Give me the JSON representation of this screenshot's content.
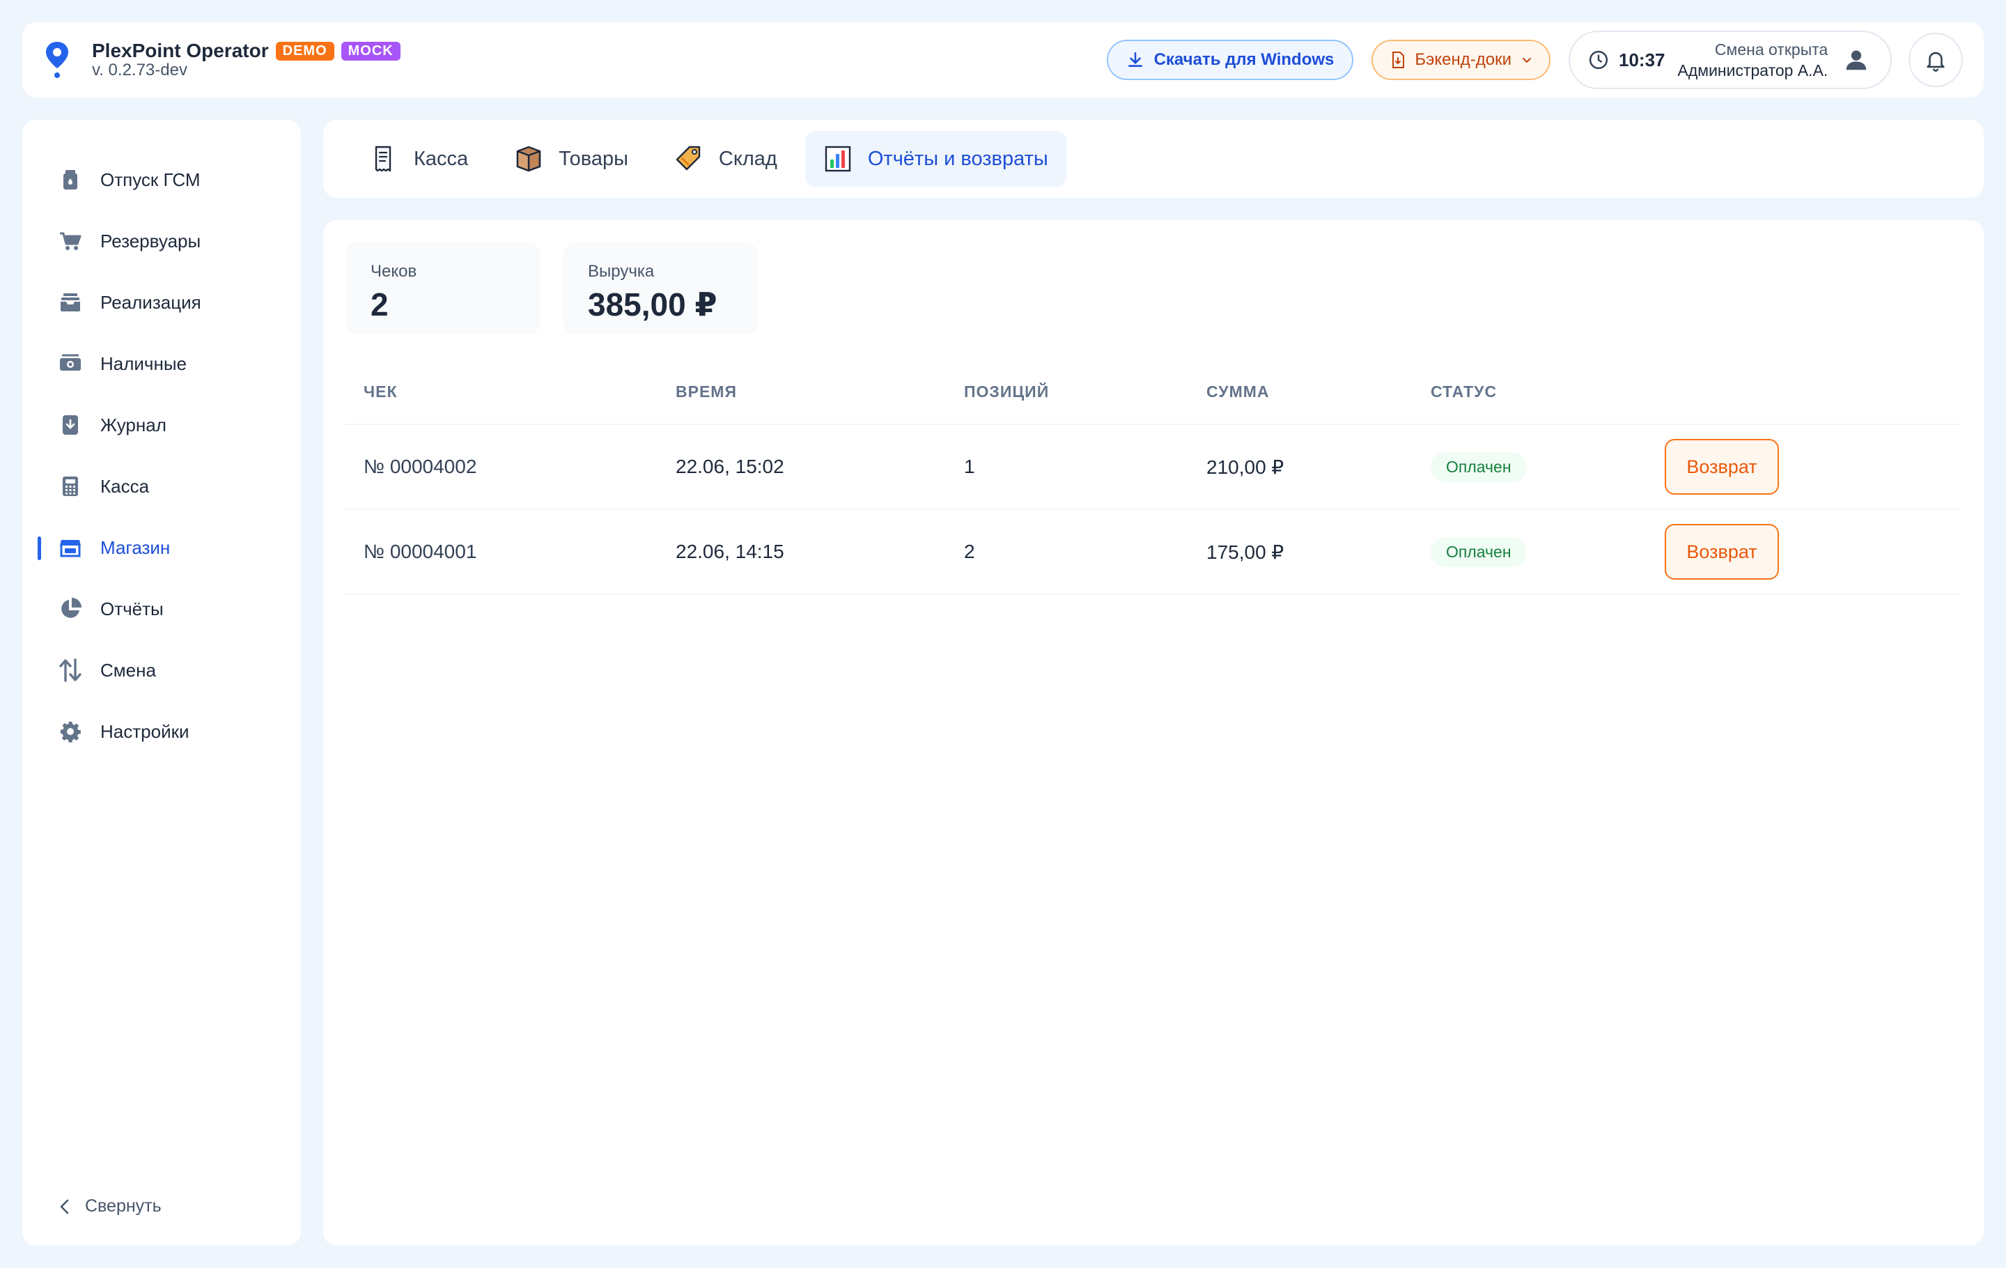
{
  "header": {
    "title": "PlexPoint Operator",
    "badge_demo": "DEMO",
    "badge_mock": "MOCK",
    "version": "v. 0.2.73-dev",
    "download_label": "Скачать для Windows",
    "docs_label": "Бэкенд-доки",
    "time": "10:37",
    "shift_status": "Смена открыта",
    "user": "Администратор А.А."
  },
  "sidebar": {
    "items": [
      {
        "label": "Отпуск ГСМ",
        "icon": "fuel-can-icon"
      },
      {
        "label": "Резервуары",
        "icon": "cart-icon"
      },
      {
        "label": "Реализация",
        "icon": "inbox-icon"
      },
      {
        "label": "Наличные",
        "icon": "cash-icon"
      },
      {
        "label": "Журнал",
        "icon": "journal-icon"
      },
      {
        "label": "Касса",
        "icon": "calculator-icon"
      },
      {
        "label": "Магазин",
        "icon": "store-icon"
      },
      {
        "label": "Отчёты",
        "icon": "pie-chart-icon"
      },
      {
        "label": "Смена",
        "icon": "swap-arrows-icon"
      },
      {
        "label": "Настройки",
        "icon": "gear-icon"
      }
    ],
    "active_index": 6,
    "collapse_label": "Свернуть"
  },
  "tabs": [
    {
      "label": "Касса",
      "icon": "receipt-icon"
    },
    {
      "label": "Товары",
      "icon": "box-icon"
    },
    {
      "label": "Склад",
      "icon": "tag-icon"
    },
    {
      "label": "Отчёты и возвраты",
      "icon": "bar-chart-icon"
    }
  ],
  "active_tab": 3,
  "stats": {
    "checks_label": "Чеков",
    "checks_value": "2",
    "revenue_label": "Выручка",
    "revenue_value": "385,00 ₽"
  },
  "table": {
    "columns": [
      "ЧЕК",
      "ВРЕМЯ",
      "ПОЗИЦИЙ",
      "СУММА",
      "СТАТУС"
    ],
    "rows": [
      {
        "check": "№ 00004002",
        "time": "22.06, 15:02",
        "positions": "1",
        "sum": "210,00 ₽",
        "status": "Оплачен",
        "action": "Возврат"
      },
      {
        "check": "№ 00004001",
        "time": "22.06, 14:15",
        "positions": "2",
        "sum": "175,00 ₽",
        "status": "Оплачен",
        "action": "Возврат"
      }
    ]
  },
  "colors": {
    "accent": "#2563eb",
    "page_bg": "#eff5fd",
    "demo_badge": "#f97316",
    "mock_badge": "#a855f7",
    "return_button": "#f97316",
    "status_paid": "#15803d"
  }
}
